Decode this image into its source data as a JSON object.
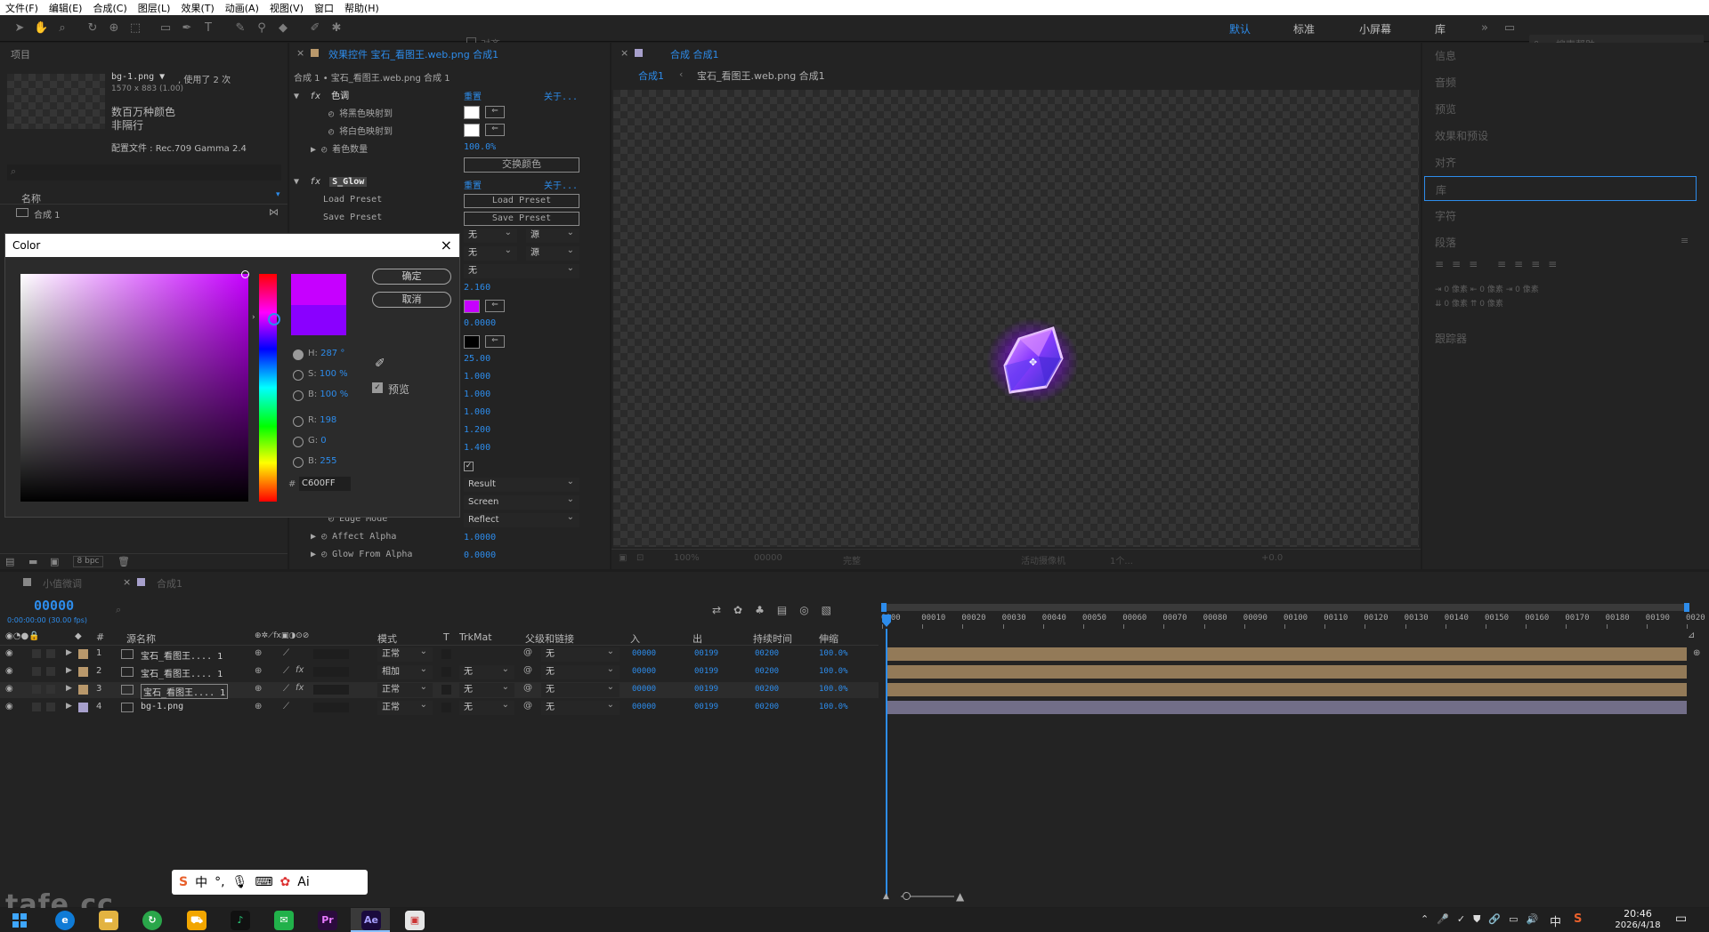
{
  "menubar": {
    "items": [
      "文件(F)",
      "编辑(E)",
      "合成(C)",
      "图层(L)",
      "效果(T)",
      "动画(A)",
      "视图(V)",
      "窗口",
      "帮助(H)"
    ]
  },
  "toolbar": {
    "align_label": "对齐",
    "workspaces": [
      "默认",
      "标准",
      "小屏幕",
      "库"
    ],
    "search_placeholder": "搜索帮助"
  },
  "project": {
    "tab": "项目",
    "asset_name": "bg-1.png ▼",
    "usage": ", 使用了 2 次",
    "dims": "1570 x 883 (1.00)",
    "color_mode": "数百万种颜色",
    "interlace": "非隔行",
    "profile": "配置文件 : Rec.709 Gamma 2.4",
    "col_name": "名称",
    "items": [
      "合成 1"
    ],
    "bpc": "8 bpc"
  },
  "effects": {
    "tab": "效果控件 宝石_看图王.web.png 合成1",
    "breadcrumb": "合成 1 • 宝石_看图王.web.png 合成 1",
    "fx1_name": "色调",
    "reset": "重置",
    "about": "关于...",
    "fx1_props": [
      "将黑色映射到",
      "将白色映射到",
      "着色数量"
    ],
    "tint_amount": "100.0%",
    "swap_colors": "交换颜色",
    "fx2_name": "S_Glow",
    "load_preset": "Load Preset",
    "save_preset": "Save Preset",
    "dropdowns": [
      "无",
      "源",
      "无",
      "源",
      "无"
    ],
    "values": [
      "2.160",
      "0.0000",
      "25.00",
      "1.000",
      "1.000",
      "1.000",
      "1.200",
      "1.400"
    ],
    "result": "Result",
    "screen": "Screen",
    "edge_mode_label": "Edge Mode",
    "edge_mode": "Reflect",
    "affect_alpha_label": "Affect Alpha",
    "affect_alpha": "1.0000",
    "glow_alpha_label": "Glow From Alpha",
    "glow_alpha": "0.0000"
  },
  "color_dialog": {
    "title": "Color",
    "ok": "确定",
    "cancel": "取消",
    "preview": "预览",
    "H": "287 °",
    "S": "100 %",
    "B": "100 %",
    "R": "198",
    "G": "0",
    "B2": "255",
    "hex": "C600FF",
    "colors": {
      "current": "#c600ff",
      "previous": "#8a00ff"
    }
  },
  "comp": {
    "tab": "合成 合成1",
    "crumb1": "合成1",
    "crumb2": "宝石_看图王.web.png 合成1",
    "zoom": "100%",
    "time": "00000",
    "quality": "完整",
    "camera": "活动摄像机",
    "views": "1个...",
    "exposure": "+0.0"
  },
  "right_panel": {
    "items": [
      "信息",
      "音频",
      "预览",
      "效果和预设",
      "对齐",
      "库",
      "字符",
      "段落",
      "跟踪器"
    ],
    "para_vals": [
      "0 像素",
      "0 像素",
      "0 像素",
      "0 像素",
      "0 像素"
    ]
  },
  "timeline": {
    "tab1": "小值微调",
    "tab2": "合成1",
    "timecode": "00000",
    "timecode_sub": "0:00:00:00 (30.00 fps)",
    "headers": {
      "num": "#",
      "source": "源名称",
      "mode": "模式",
      "t": "T",
      "trkmat": "TrkMat",
      "parent": "父级和链接",
      "in": "入",
      "out": "出",
      "dur": "持续时间",
      "stretch": "伸缩"
    },
    "ruler": [
      "0000",
      "00010",
      "00020",
      "00030",
      "00040",
      "00050",
      "00060",
      "00070",
      "00080",
      "00090",
      "00100",
      "00110",
      "00120",
      "00130",
      "00140",
      "00150",
      "00160",
      "00170",
      "00180",
      "00190",
      "0020"
    ],
    "layers": [
      {
        "num": "1",
        "name": "宝石_看图王.... 1",
        "mode": "正常",
        "trk": "",
        "parent": "无",
        "in": "00000",
        "out": "00199",
        "dur": "00200",
        "str": "100.0%",
        "color": "#b9986b"
      },
      {
        "num": "2",
        "name": "宝石_看图王.... 1",
        "mode": "相加",
        "trk": "无",
        "parent": "无",
        "in": "00000",
        "out": "00199",
        "dur": "00200",
        "str": "100.0%",
        "color": "#b9986b"
      },
      {
        "num": "3",
        "name": "宝石_看图王.... 1",
        "mode": "正常",
        "trk": "无",
        "parent": "无",
        "in": "00000",
        "out": "00199",
        "dur": "00200",
        "str": "100.0%",
        "color": "#b9986b"
      },
      {
        "num": "4",
        "name": "bg-1.png",
        "mode": "正常",
        "trk": "无",
        "parent": "无",
        "in": "00000",
        "out": "00199",
        "dur": "00200",
        "str": "100.0%",
        "color": "#a7a0cc"
      }
    ]
  },
  "ime": {
    "items": [
      "中",
      "°,",
      "Ai"
    ]
  },
  "watermark": "tafe.cc",
  "taskbar": {
    "time": "20:46",
    "date": "2026/4/18",
    "ime": "中",
    "apps": [
      "Pr",
      "Ae"
    ]
  }
}
